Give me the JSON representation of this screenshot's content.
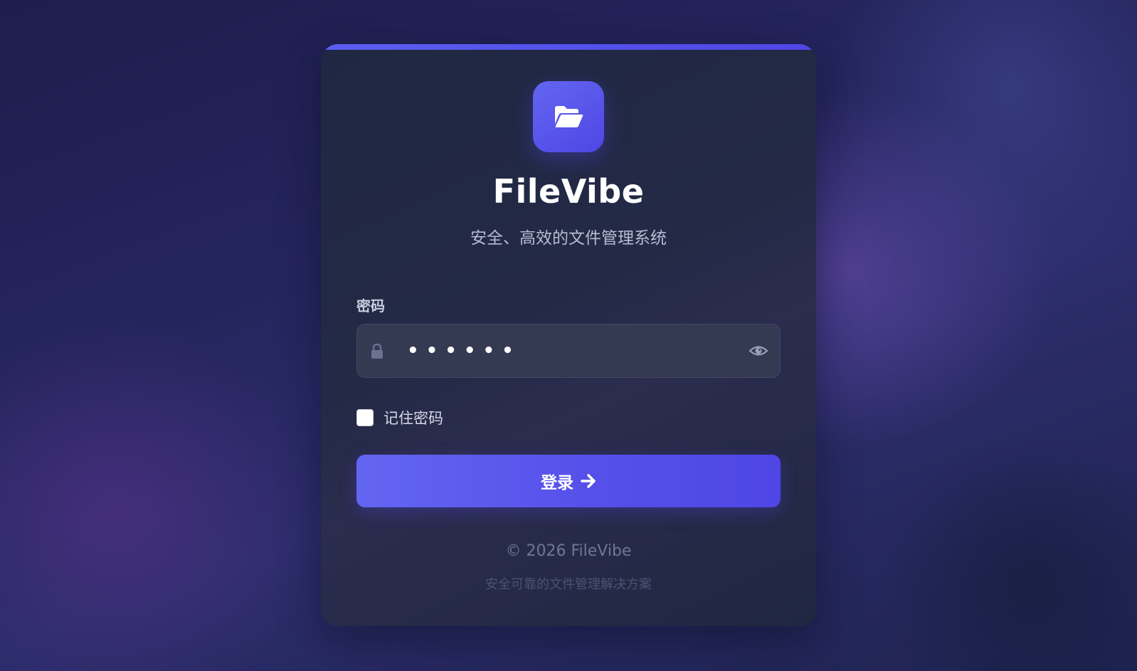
{
  "app": {
    "name": "FileVibe",
    "subtitle": "安全、高效的文件管理系统",
    "logo_icon": "folder-open-icon"
  },
  "form": {
    "password_label": "密码",
    "password_value": "••••••",
    "lock_icon": "lock-icon",
    "toggle_visibility_icon": "eye-icon",
    "remember_label": "记住密码",
    "remember_checked": false,
    "submit_label": "登录",
    "submit_icon": "arrow-right-icon"
  },
  "footer": {
    "copyright": "© 2026 FileVibe",
    "tagline": "安全可靠的文件管理解决方案"
  },
  "colors": {
    "accent": "#4f46e5",
    "accent_light": "#6366f1",
    "card_background": "#232a45",
    "page_background": "#262660"
  }
}
